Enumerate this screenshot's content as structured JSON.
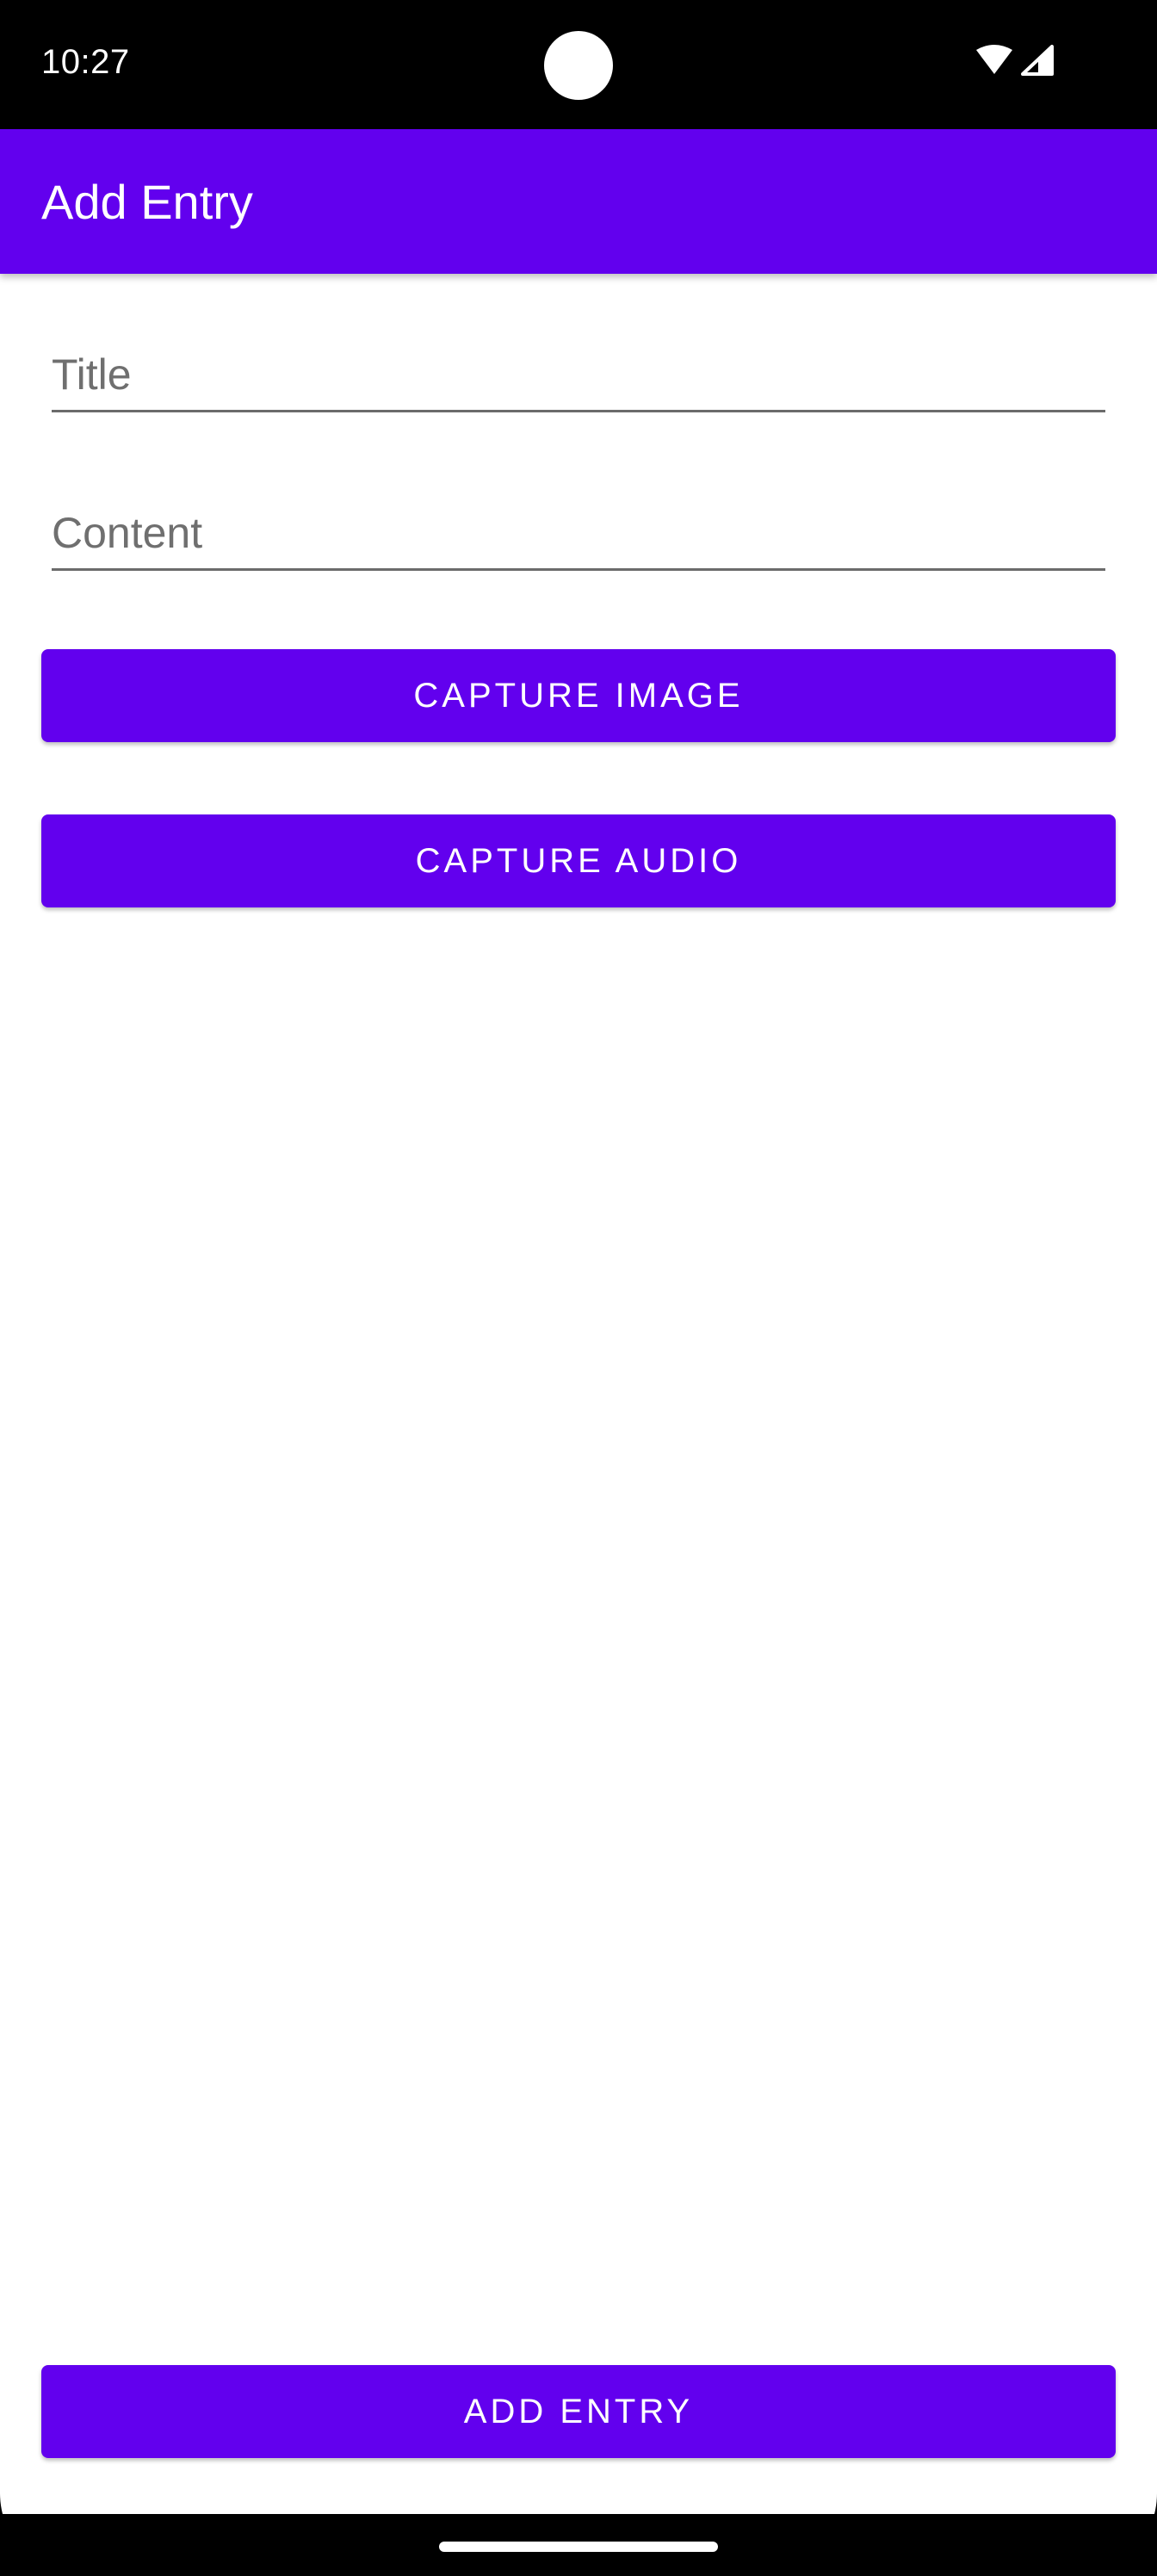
{
  "status_bar": {
    "time": "10:27",
    "icons": [
      "wifi-icon",
      "cellular-signal-icon"
    ]
  },
  "app_bar": {
    "title": "Add Entry"
  },
  "form": {
    "title_field": {
      "value": "",
      "placeholder": "Title"
    },
    "content_field": {
      "value": "",
      "placeholder": "Content"
    }
  },
  "buttons": {
    "capture_image": "CAPTURE IMAGE",
    "capture_audio": "CAPTURE AUDIO",
    "add_entry": "ADD ENTRY"
  },
  "colors": {
    "primary": "#6200ee",
    "on_primary": "#ffffff",
    "background": "#ffffff",
    "status_bar": "#000000"
  }
}
